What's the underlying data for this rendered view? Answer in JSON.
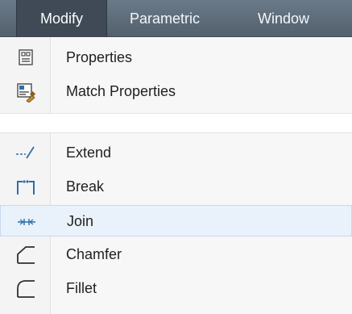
{
  "menubar": {
    "items": [
      {
        "label": "Modify"
      },
      {
        "label": "Parametric"
      },
      {
        "label": "Window"
      }
    ]
  },
  "menu": {
    "group1": [
      {
        "label": "Properties",
        "icon": "properties-icon"
      },
      {
        "label": "Match Properties",
        "icon": "match-properties-icon"
      }
    ],
    "group2": [
      {
        "label": "Extend",
        "icon": "extend-icon"
      },
      {
        "label": "Break",
        "icon": "break-icon"
      },
      {
        "label": "Join",
        "icon": "join-icon"
      },
      {
        "label": "Chamfer",
        "icon": "chamfer-icon"
      },
      {
        "label": "Fillet",
        "icon": "fillet-icon"
      }
    ]
  },
  "colors": {
    "menubar_bg": "#5f6d7b",
    "active_bg": "#3f4a56",
    "hover_bg": "#e9f1fb",
    "icon_blue": "#2e6ea8"
  }
}
